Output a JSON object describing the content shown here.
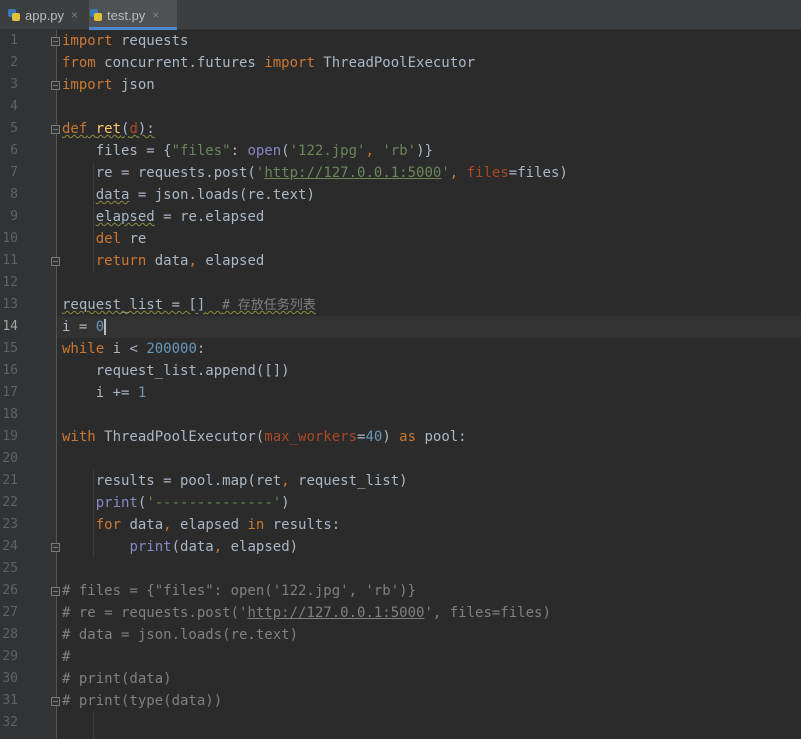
{
  "tabs": [
    {
      "label": "app.py",
      "active": false,
      "icon": "python-file-icon",
      "close": "×"
    },
    {
      "label": "test.py",
      "active": true,
      "icon": "python-file-icon",
      "close": "×"
    }
  ],
  "line_numbers": [
    "1",
    "2",
    "3",
    "4",
    "5",
    "6",
    "7",
    "8",
    "9",
    "10",
    "11",
    "12",
    "13",
    "14",
    "15",
    "16",
    "17",
    "18",
    "19",
    "20",
    "21",
    "22",
    "23",
    "24",
    "25",
    "26",
    "27",
    "28",
    "29",
    "30",
    "31",
    "32"
  ],
  "current_line": 14,
  "code": {
    "l1": {
      "k1": "import",
      "t1": " requests"
    },
    "l2": {
      "k1": "from",
      "t1": " concurrent.futures ",
      "k2": "import",
      "t2": " ThreadPoolExecutor"
    },
    "l3": {
      "k1": "import",
      "t1": " json"
    },
    "l5": {
      "k1": "def",
      "t0": " ",
      "fn": "ret",
      "t1": "(",
      "p": "d",
      "t2": "):"
    },
    "l6": {
      "t1": "    files = {",
      "s1": "\"files\"",
      "t2": ": ",
      "b1": "open",
      "t3": "(",
      "s2": "'122.jpg'",
      "k1": ",",
      "t4": " ",
      "s3": "'rb'",
      "t5": ")}"
    },
    "l7": {
      "t1": "    re = requests.post(",
      "s1": "'",
      "url": "http://127.0.0.1:5000",
      "s2": "'",
      "k1": ",",
      "t2": " ",
      "p": "files",
      "t3": "=files)"
    },
    "l8": {
      "t0": "    ",
      "w": "data",
      "t1": " = json.loads(re.text)"
    },
    "l9": {
      "t0": "    ",
      "w": "elapsed",
      "t1": " = re.elapsed"
    },
    "l10": {
      "t0": "    ",
      "k1": "del",
      "t1": " re"
    },
    "l11": {
      "t0": "    ",
      "k1": "return",
      "t1": " data",
      "k2": ",",
      "t2": " elapsed"
    },
    "l13": {
      "w": "request_list = []",
      "t1": "  ",
      "c": "# 存放任务列表"
    },
    "l14": {
      "t1": "i = ",
      "n": "0"
    },
    "l15": {
      "k1": "while",
      "t1": " i < ",
      "n": "200000",
      "t2": ":"
    },
    "l16": {
      "t1": "    request_list.append([])"
    },
    "l17": {
      "t1": "    i += ",
      "n": "1"
    },
    "l19": {
      "k1": "with",
      "t1": " ThreadPoolExecutor(",
      "p": "max_workers",
      "t2": "=",
      "n": "40",
      "t3": ") ",
      "k2": "as",
      "t4": " pool:"
    },
    "l21": {
      "t1": "    results = pool.map(ret",
      "k1": ",",
      "t2": " request_list)"
    },
    "l22": {
      "t0": "    ",
      "b1": "print",
      "t1": "(",
      "s1": "'--------------'",
      "t2": ")"
    },
    "l23": {
      "t0": "    ",
      "k1": "for",
      "t1": " data",
      "k2": ",",
      "t2": " elapsed ",
      "k3": "in",
      "t3": " results:"
    },
    "l24": {
      "t0": "        ",
      "b1": "print",
      "t1": "(data",
      "k1": ",",
      "t2": " elapsed)"
    },
    "l26": {
      "c": "# files = {\"files\": open('122.jpg', 'rb')}"
    },
    "l27": {
      "c1": "# re = requests.post('",
      "url": "http://127.0.0.1:5000",
      "c2": "', files=files)"
    },
    "l28": {
      "c": "# data = json.loads(re.text)"
    },
    "l29": {
      "c": "#"
    },
    "l30": {
      "c": "# print(data)"
    },
    "l31": {
      "c": "# print(type(data))"
    }
  }
}
